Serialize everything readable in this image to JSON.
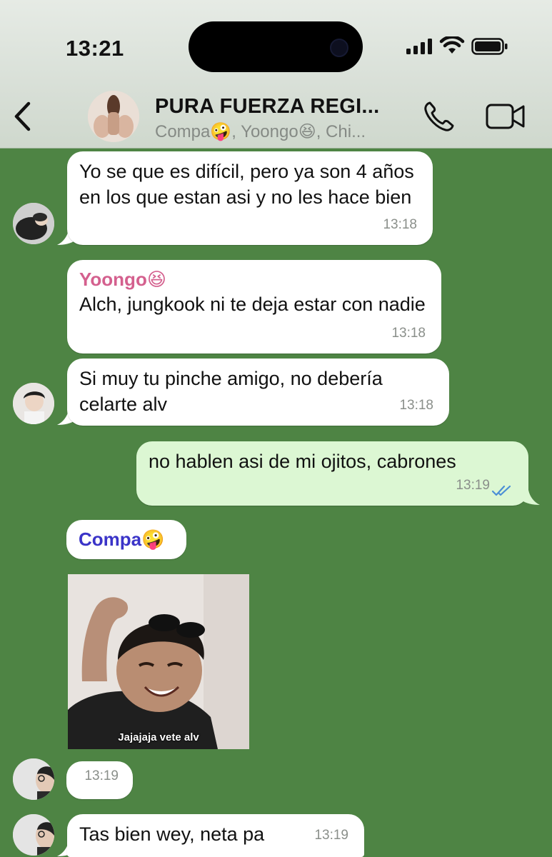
{
  "status_bar": {
    "time": "13:21"
  },
  "header": {
    "title": "PURA FUERZA REGI...",
    "members": "Compa🤪, Yoongo😆, Chi..."
  },
  "messages": [
    {
      "text": "Yo se que es difícil, pero ya son 4 años en los que estan asi y no les hace bien",
      "time": "13:18"
    },
    {
      "sender": "Yoongo😆",
      "sender_color": "#d4608e",
      "text": "Alch, jungkook ni te deja estar con nadie",
      "time": "13:18"
    },
    {
      "text": "Si muy tu pinche amigo, no debería celarte alv",
      "time": "13:18"
    },
    {
      "text": "no hablen asi de mi ojitos, cabrones",
      "time": "13:19",
      "outgoing": true,
      "status": "read"
    },
    {
      "sender": "Compa🤪",
      "sender_color": "#3b34c8"
    },
    {
      "sticker_caption": "Jajajaja vete alv",
      "time": "13:19"
    },
    {
      "text": "Tas bien wey, neta pa",
      "time": "13:19"
    }
  ],
  "colors": {
    "chat_background": "#4e8444",
    "incoming_bubble": "#ffffff",
    "outgoing_bubble": "#dcf7d3",
    "read_ticks": "#4b8fd6"
  }
}
